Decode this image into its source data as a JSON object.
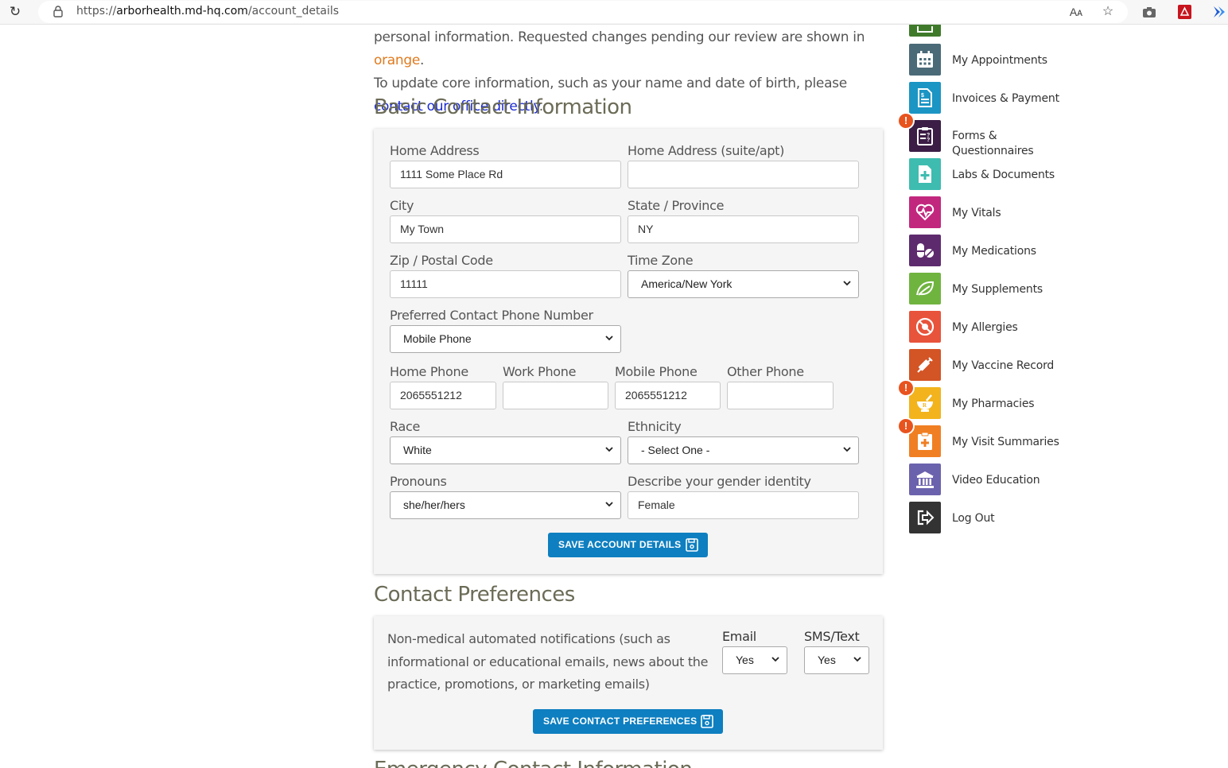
{
  "browser": {
    "url_prefix": "https://",
    "url_host": "arborhealth.md-hq.com",
    "url_path": "/account_details"
  },
  "intro": {
    "line1_a": "personal information. Requested changes pending our review are shown in ",
    "line1_orange": "orange",
    "line1_end": ".",
    "line2_a": "To update core information, such as your name and date of birth, please ",
    "link": "contact our office directly",
    "line2_end": "."
  },
  "basic": {
    "title": "Basic Contact Information",
    "home_address_label": "Home Address",
    "home_address_value": "1111 Some Place Rd",
    "suite_label": "Home Address (suite/apt)",
    "suite_value": "",
    "city_label": "City",
    "city_value": "My Town",
    "state_label": "State / Province",
    "state_value": "NY",
    "zip_label": "Zip / Postal Code",
    "zip_value": "11111",
    "timezone_label": "Time Zone",
    "timezone_value": "America/New York",
    "pref_phone_label": "Preferred Contact Phone Number",
    "pref_phone_value": "Mobile Phone",
    "home_phone_label": "Home Phone",
    "home_phone_value": "2065551212",
    "work_phone_label": "Work Phone",
    "work_phone_value": "",
    "mobile_phone_label": "Mobile Phone",
    "mobile_phone_value": "2065551212",
    "other_phone_label": "Other Phone",
    "other_phone_value": "",
    "race_label": "Race",
    "race_value": "White",
    "ethnicity_label": "Ethnicity",
    "ethnicity_value": "- Select One -",
    "pronouns_label": "Pronouns",
    "pronouns_value": "she/her/hers",
    "gender_label": "Describe your gender identity",
    "gender_value": "Female",
    "save_label": "SAVE ACCOUNT DETAILS"
  },
  "prefs": {
    "title": "Contact Preferences",
    "desc_1": "Non-medical automated notifications (such as",
    "desc_2": "informational or educational emails, news about the",
    "desc_3": "practice, promotions, or marketing emails)",
    "email_label": "Email",
    "email_value": "Yes",
    "sms_label": "SMS/Text",
    "sms_value": "Yes",
    "save_label": "SAVE CONTACT PREFERENCES"
  },
  "next_section_partial": "Emergency Contact Information",
  "nav": [
    {
      "label": "My Appointments",
      "icon": "calendar-icon",
      "color": "#4a6a78"
    },
    {
      "label": "Invoices & Payment",
      "icon": "invoice-icon",
      "color": "#1b95c4"
    },
    {
      "label": "Forms & Questionnaires",
      "icon": "clipboard-question-icon",
      "color": "#3b1d45"
    },
    {
      "label": "Labs & Documents",
      "icon": "lab-document-icon",
      "color": "#3ebcb0"
    },
    {
      "label": "My Vitals",
      "icon": "heart-pulse-icon",
      "color": "#c2277e"
    },
    {
      "label": "My Medications",
      "icon": "pills-icon",
      "color": "#5e2a6e"
    },
    {
      "label": "My Supplements",
      "icon": "leaf-icon",
      "color": "#6fb43f"
    },
    {
      "label": "My Allergies",
      "icon": "allergy-icon",
      "color": "#e8533b"
    },
    {
      "label": "My Vaccine Record",
      "icon": "syringe-icon",
      "color": "#d35425"
    },
    {
      "label": "My Pharmacies",
      "icon": "mortar-pestle-icon",
      "color": "#f2b31c"
    },
    {
      "label": "My Visit Summaries",
      "icon": "clipboard-medical-icon",
      "color": "#f07f23"
    },
    {
      "label": "Video Education",
      "icon": "institution-icon",
      "color": "#6b62ad"
    },
    {
      "label": "Log Out",
      "icon": "logout-icon",
      "color": "#333333"
    }
  ],
  "alert_glyph": "!"
}
